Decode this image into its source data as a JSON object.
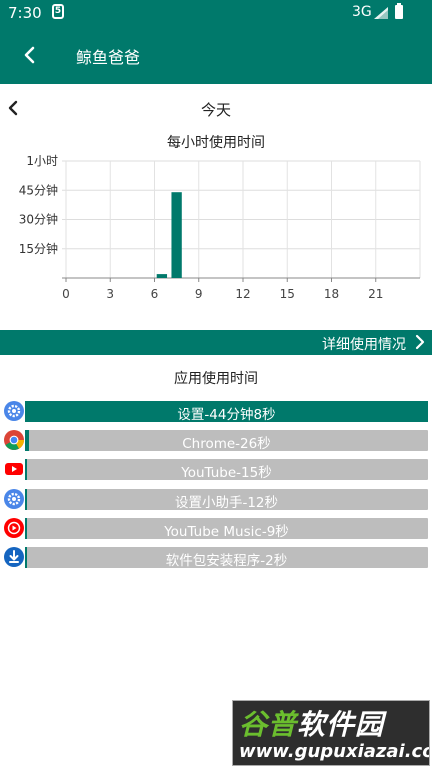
{
  "status_bar": {
    "time": "7:30",
    "sim_icon": "sim-5-icon",
    "network": "3G",
    "signal_icon": "signal-icon",
    "battery_icon": "battery-icon"
  },
  "app_bar": {
    "title": "鲸鱼爸爸",
    "back_icon": "arrow-back-icon"
  },
  "date_nav": {
    "label": "今天",
    "prev_icon": "chevron-left-icon"
  },
  "chart_data": {
    "type": "bar",
    "title": "每小时使用时间",
    "x": [
      0,
      1,
      2,
      3,
      4,
      5,
      6,
      7,
      8,
      9,
      10,
      11,
      12,
      13,
      14,
      15,
      16,
      17,
      18,
      19,
      20,
      21,
      22,
      23
    ],
    "values": [
      0,
      0,
      0,
      0,
      0,
      0,
      2,
      44,
      0,
      0,
      0,
      0,
      0,
      0,
      0,
      0,
      0,
      0,
      0,
      0,
      0,
      0,
      0,
      0
    ],
    "value_unit": "minutes",
    "xticks": [
      "0",
      "3",
      "6",
      "9",
      "12",
      "15",
      "18",
      "21"
    ],
    "xtick_positions": [
      0,
      3,
      6,
      9,
      12,
      15,
      18,
      21
    ],
    "yticks": [
      "15分钟",
      "30分钟",
      "45分钟",
      "1小时"
    ],
    "ytick_values": [
      15,
      30,
      45,
      60
    ],
    "ylim": [
      0,
      60
    ],
    "grid": true,
    "color": "#00796B"
  },
  "detail": {
    "label": "详细使用情况",
    "chevron_icon": "chevron-right-icon"
  },
  "apps_section": {
    "title": "应用使用时间",
    "items": [
      {
        "label": "设置-44分钟8秒",
        "fraction": 1.0,
        "icon": "settings-gear-icon"
      },
      {
        "label": "Chrome-26秒",
        "fraction": 0.0098,
        "icon": "chrome-icon"
      },
      {
        "label": "YouTube-15秒",
        "fraction": 0.0057,
        "icon": "youtube-icon"
      },
      {
        "label": "设置小助手-12秒",
        "fraction": 0.0045,
        "icon": "settings-gear-icon"
      },
      {
        "label": "YouTube Music-9秒",
        "fraction": 0.0034,
        "icon": "youtube-music-icon"
      },
      {
        "label": "软件包安装程序-2秒",
        "fraction": 0.0008,
        "icon": "package-installer-icon"
      }
    ]
  },
  "watermark": {
    "name_part1": "谷普",
    "name_part2": "软件园",
    "url": "www.gupuxiazai.com"
  },
  "colors": {
    "primary": "#00796B",
    "bar_bg": "#BDBDBD"
  }
}
